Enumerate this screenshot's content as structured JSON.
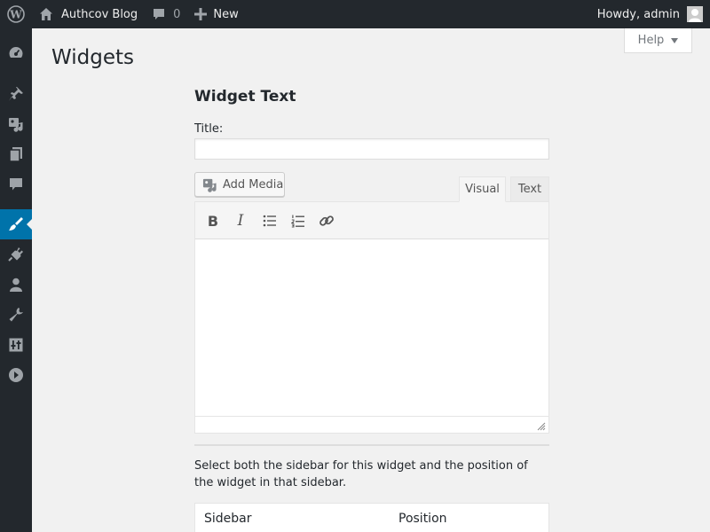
{
  "adminbar": {
    "site_name": "Authcov Blog",
    "comments_count": "0",
    "new_label": "New",
    "greeting": "Howdy, admin"
  },
  "help": {
    "label": "Help"
  },
  "page": {
    "title": "Widgets"
  },
  "widget": {
    "heading": "Widget Text",
    "title_label": "Title:",
    "title_value": "",
    "add_media_label": "Add Media",
    "tabs": {
      "visual": "Visual",
      "text": "Text"
    },
    "toolbar": {
      "bold": "B",
      "italic": "I"
    },
    "content": ""
  },
  "sidebar_select": {
    "description": "Select both the sidebar for this widget and the position of the widget in that sidebar.",
    "columns": [
      "Sidebar",
      "Position"
    ]
  },
  "menu_icons": [
    "dashboard-icon",
    "posts-icon",
    "media-icon",
    "pages-icon",
    "comments-icon",
    "appearance-icon",
    "plugins-icon",
    "users-icon",
    "tools-icon",
    "settings-icon",
    "collapse-icon"
  ],
  "colors": {
    "adminbar_bg": "#23282d",
    "menu_current": "#0073aa",
    "page_bg": "#f1f1f1"
  }
}
